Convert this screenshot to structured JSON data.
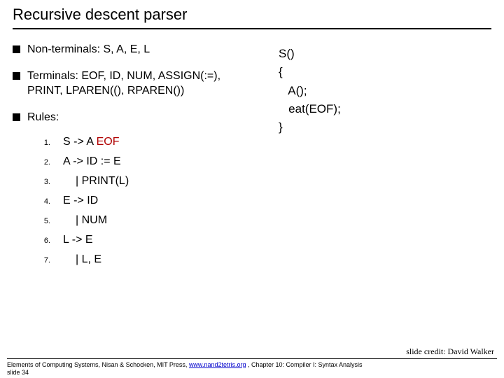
{
  "title": "Recursive descent parser",
  "bullets": {
    "nonterminals": "Non-terminals: S, A, E, L",
    "terminals": "Terminals: EOF, ID, NUM, ASSIGN(:=), PRINT, LPAREN((), RPAREN())",
    "rules_label": "Rules:"
  },
  "rules": [
    {
      "n": "1.",
      "txt_pre": "S -> A ",
      "eof": "EOF",
      "txt_post": ""
    },
    {
      "n": "2.",
      "txt_pre": "A -> ID := E",
      "eof": "",
      "txt_post": ""
    },
    {
      "n": "3.",
      "txt_pre": "   | PRINT(L)",
      "eof": "",
      "txt_post": ""
    },
    {
      "n": "4.",
      "txt_pre": "E -> ID",
      "eof": "",
      "txt_post": ""
    },
    {
      "n": "5.",
      "txt_pre": "   |  NUM",
      "eof": "",
      "txt_post": ""
    },
    {
      "n": "6.",
      "txt_pre": "L -> E",
      "eof": "",
      "txt_post": ""
    },
    {
      "n": "7.",
      "txt_pre": "   | L, E",
      "eof": "",
      "txt_post": ""
    }
  ],
  "code": {
    "l1": "S()",
    "l2": "{",
    "l3": "   A();",
    "l4": "   eat(EOF);",
    "l5": "}"
  },
  "credit": "slide credit: David Walker",
  "footer": {
    "text_pre": "Elements of Computing Systems, Nisan & Schocken, MIT Press, ",
    "link": "www.nand2tetris.org",
    "text_post": " , Chapter 10: Compiler I: Syntax Analysis",
    "slide_num": "slide 34"
  }
}
